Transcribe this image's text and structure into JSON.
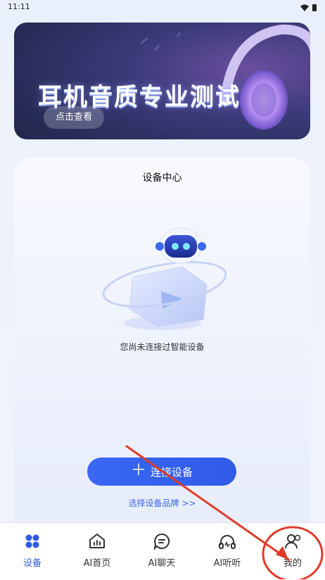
{
  "status_bar": {
    "time": "11:11"
  },
  "banner": {
    "title": "耳机音质专业测试",
    "button_label": "点击查看"
  },
  "device_center": {
    "title": "设备中心",
    "empty_message": "您尚未连接过智能设备",
    "connect_button_label": "连接设备",
    "select_brand_link": "选择设备品牌 >>"
  },
  "tab_bar": {
    "items": [
      {
        "label": "设备",
        "icon": "grid-dots-icon",
        "active": true
      },
      {
        "label": "AI首页",
        "icon": "home-chart-icon",
        "active": false
      },
      {
        "label": "AI聊天",
        "icon": "chat-bubble-icon",
        "active": false
      },
      {
        "label": "AI听听",
        "icon": "headphones-icon",
        "active": false
      },
      {
        "label": "我的",
        "icon": "profile-icon",
        "active": false
      }
    ]
  },
  "colors": {
    "accent": "#2f5be8",
    "annotation": "#e03a2a"
  }
}
